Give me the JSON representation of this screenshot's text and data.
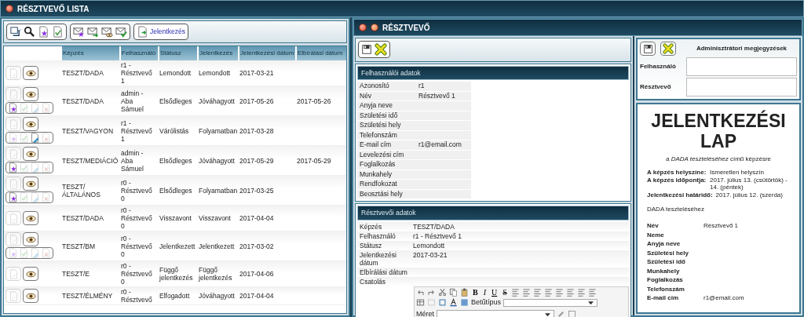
{
  "window": {
    "title": "RÉSZTVEVŐ LISTA"
  },
  "list": {
    "toolbar_groups": [
      [
        {
          "kind": "refresh"
        },
        {
          "kind": "search"
        },
        {
          "kind": "add"
        },
        {
          "kind": "approve"
        }
      ],
      [
        {
          "kind": "mail-add"
        },
        {
          "kind": "mail-send"
        },
        {
          "kind": "mail-view"
        },
        {
          "kind": "mail-approve"
        }
      ]
    ],
    "register_button": "Jelentkezés",
    "columns": [
      "Képzés",
      "Felhasználó",
      "Státusz",
      "Jelentkezés",
      "Jelentkezési dátum",
      "Elbírálási dátum"
    ],
    "rows": [
      {
        "training": "TESZT/DADA",
        "user": "r1 - Résztvevő 1",
        "status": "Lemondott",
        "application": "Lemondott",
        "applied_date": "2017-03-21"
      },
      {
        "training": "TESZT/DADA",
        "user": "admin - Aba Sámuel",
        "status": "Elsődleges",
        "application": "Jóváhagyott",
        "applied_date": "2017-05-26",
        "decision_date": "2017-05-26",
        "actions": [
          {
            "kind": "add",
            "enabled": true
          },
          {
            "kind": "approve",
            "enabled": false
          },
          {
            "kind": "edit",
            "enabled": false
          },
          {
            "kind": "reject",
            "enabled": false
          }
        ]
      },
      {
        "training": "TESZT/VAGYON",
        "user": "r1 - Résztvevő 1",
        "status": "Várólistás",
        "application": "Folyamatban",
        "applied_date": "2017-03-28",
        "actions": [
          {
            "kind": "add",
            "enabled": false
          },
          {
            "kind": "approve",
            "enabled": false
          },
          {
            "kind": "edit",
            "enabled": true
          },
          {
            "kind": "reject",
            "enabled": false
          }
        ]
      },
      {
        "training": "TESZT/MEDIÁCIÓ",
        "user": "admin - Aba Sámuel",
        "status": "Elsődleges",
        "application": "Jóváhagyott",
        "applied_date": "2017-05-29",
        "decision_date": "2017-05-29",
        "actions": [
          {
            "kind": "add",
            "enabled": true
          },
          {
            "kind": "approve",
            "enabled": false
          },
          {
            "kind": "edit",
            "enabled": false
          },
          {
            "kind": "reject",
            "enabled": false
          }
        ]
      },
      {
        "training": "TESZT/ ÁLTALÁNOS",
        "user": "r0 - Résztvevő 0",
        "status": "Elsődleges",
        "application": "Folyamatban",
        "applied_date": "2017-03-25",
        "actions": [
          {
            "kind": "add",
            "enabled": true
          },
          {
            "kind": "approve",
            "enabled": false
          },
          {
            "kind": "edit",
            "enabled": false
          },
          {
            "kind": "reject",
            "enabled": false
          }
        ]
      },
      {
        "training": "TESZT/DADA",
        "user": "r0 - Résztvevő 0",
        "status": "Visszavont",
        "application": "Visszavont",
        "applied_date": "2017-04-04"
      },
      {
        "training": "TESZT/BM",
        "user": "r0 - Résztvevő 0",
        "status": "Jelentkezett",
        "application": "Jelentkezett",
        "applied_date": "2017-03-02",
        "actions": [
          {
            "kind": "add",
            "enabled": false
          },
          {
            "kind": "approve",
            "enabled": false
          },
          {
            "kind": "edit",
            "enabled": false
          },
          {
            "kind": "reject",
            "enabled": false
          }
        ]
      },
      {
        "training": "TESZT/E",
        "user": "r0 - Résztvevő 0",
        "status": "Függő jelentkezés",
        "application": "Függő jelentkezés",
        "applied_date": "2017-04-06"
      },
      {
        "training": "TESZT/ÉLMÉNY",
        "user": "r0 - Résztvevő",
        "status": "Elfogadott",
        "application": "Jóváhagyott",
        "applied_date": "2017-04-04"
      }
    ]
  },
  "detail": {
    "title": "RÉSZTVEVŐ",
    "user_section": {
      "title": "Felhasználói adatok",
      "fields": [
        {
          "label": "Azonosító",
          "value": "r1"
        },
        {
          "label": "Név",
          "value": "Résztvevő 1"
        },
        {
          "label": "Anyja neve"
        },
        {
          "label": "Születési idő"
        },
        {
          "label": "Születési hely"
        },
        {
          "label": "Telefonszám"
        },
        {
          "label": "E-mail cím",
          "value": "r1@email.com"
        },
        {
          "label": "Levelezési cím"
        },
        {
          "label": "Foglalkozás"
        },
        {
          "label": "Munkahely"
        },
        {
          "label": "Rendfokozat"
        },
        {
          "label": "Beosztási hely"
        }
      ]
    },
    "participant_section": {
      "title": "Résztvevői adatok",
      "fields": [
        {
          "label": "Képzés",
          "value": "TESZT/DADA"
        },
        {
          "label": "Felhasználó",
          "value": "r1 - Résztvevő 1"
        },
        {
          "label": "Státusz",
          "value": "Lemondott"
        },
        {
          "label": "Jelentkezési dátum",
          "value": "2017-03-21"
        },
        {
          "label": "Elbírálási dátum"
        }
      ],
      "attachment_label": "Csatolás",
      "editor": {
        "format_buttons": [
          "B",
          "I",
          "U",
          "S"
        ],
        "font_label": "Betűtípus",
        "size_label": "Méret"
      }
    }
  },
  "admin_notes": {
    "title": "Adminisztrátori megjegyzések",
    "fields": [
      {
        "label": "Felhasználó"
      },
      {
        "label": "Résztvevő"
      }
    ]
  },
  "form": {
    "title": "JELENTKEZÉSI LAP",
    "subtitle": "a *DADA teszteléséhez* című képzésre",
    "info": [
      {
        "label": "A képzés helyszíne:",
        "value": "Ismeretlen helyszín"
      },
      {
        "label": "A képzés időpontja:",
        "value": "2017. július 13. (csütörtök) - 14. (péntek)"
      },
      {
        "label": "Jelentkezési határidő:",
        "value": "2017. július 12. (szerda)"
      }
    ],
    "course": "DADA teszteléséhez",
    "fields": [
      {
        "label": "Név",
        "value": "Résztvevő 1"
      },
      {
        "label": "Neme"
      },
      {
        "label": "Anyja neve"
      },
      {
        "label": "Születési hely"
      },
      {
        "label": "Születési idő"
      },
      {
        "label": "Munkahely"
      },
      {
        "label": "Foglalkozás"
      },
      {
        "label": "Telefonszám"
      },
      {
        "label": "E-mail cím",
        "value": "r1@email.com"
      }
    ]
  }
}
